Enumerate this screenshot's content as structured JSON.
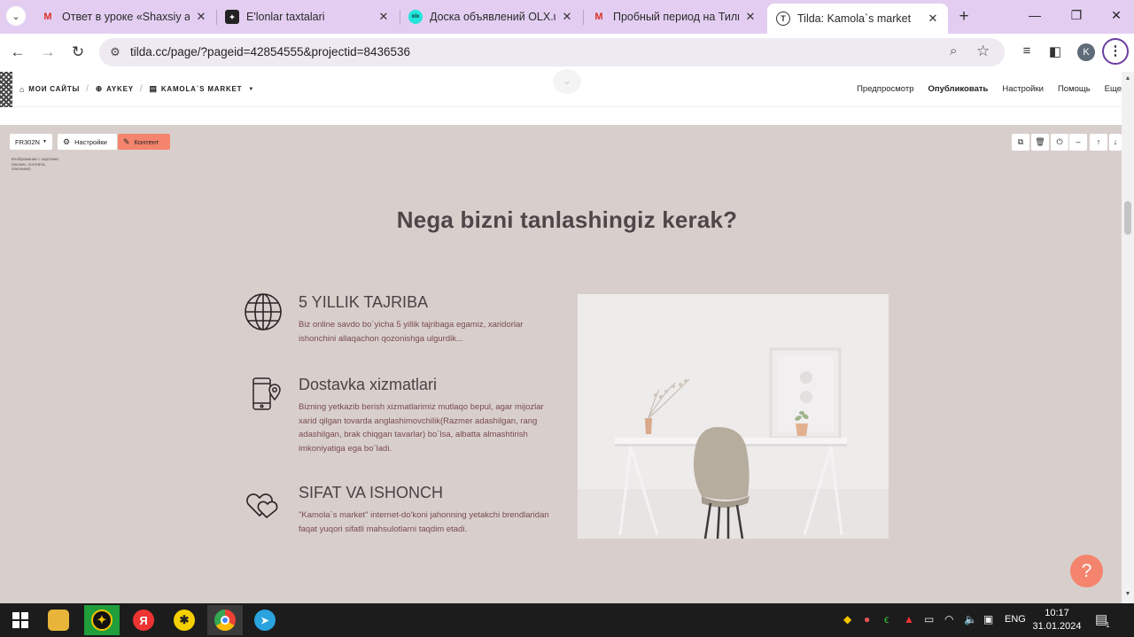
{
  "browser": {
    "tabs": [
      {
        "title": "Ответ в уроке «Shaxsiy aloq",
        "favicon": "gmail-icon"
      },
      {
        "title": "E'lonlar taxtalari",
        "favicon": "dark-square-icon"
      },
      {
        "title": "Доска объявлений OLX.uz",
        "favicon": "olx-icon"
      },
      {
        "title": "Пробный период на Тильд",
        "favicon": "gmail-icon"
      },
      {
        "title": "Tilda: Kamola`s market",
        "favicon": "tilda-icon",
        "active": true
      }
    ],
    "url": "tilda.cc/page/?pageid=42854555&projectid=8436536",
    "profile_initial": "K"
  },
  "tilda": {
    "breadcrumbs": [
      {
        "label": "МОИ САЙТЫ",
        "icon": "home-icon"
      },
      {
        "label": "AYKEY",
        "icon": "globe-icon"
      },
      {
        "label": "KAMOLA`S MARKET",
        "icon": "page-icon"
      }
    ],
    "top_links": [
      "Предпросмотр",
      "Опубликовать",
      "Настройки",
      "Помощь",
      "Еще"
    ],
    "block_id": "FR302N",
    "settings_label": "Настройки",
    "content_label": "Контент",
    "block_note": "Изображение с картинки (иконки, логотипа, описание)"
  },
  "content": {
    "title": "Nega bizni tanlashingiz kerak?",
    "features": [
      {
        "icon": "globe-icon",
        "heading": "5 YILLIK TAJRIBA",
        "text": "Biz online savdo bo`yicha 5 yillik tajribaga egamiz, xaridorlar ishonchini allaqachon qozonishga ulgurdik..."
      },
      {
        "icon": "phone-location-icon",
        "heading": "Dostavka xizmatlari",
        "text": "Bizning yetkazib berish xizmatlarimiz mutlaqo bepul, agar mijozlar xarid qilgan tovarda anglashimovchilik(Razmer adashilgan, rang adashilgan, brak chiqgan tavarlar) bo`lsa, albatta almashtirish imkoniyatiga ega bo`ladi."
      },
      {
        "icon": "hearts-icon",
        "heading": "SIFAT VA ISHONCH",
        "text": "\"Kamola`s market\" internet-do'koni jahonning yetakchi brendlaridan faqat yuqori sifatli mahsulotlarni taqdim etadi."
      }
    ],
    "help_label": "?"
  },
  "taskbar": {
    "lang": "ENG",
    "time": "10:17",
    "date": "31.01.2024",
    "notification_count": "1"
  },
  "colors": {
    "accent": "#f4846d",
    "page_bg": "#d8cfcc",
    "tab_strip": "#e3cef2"
  }
}
